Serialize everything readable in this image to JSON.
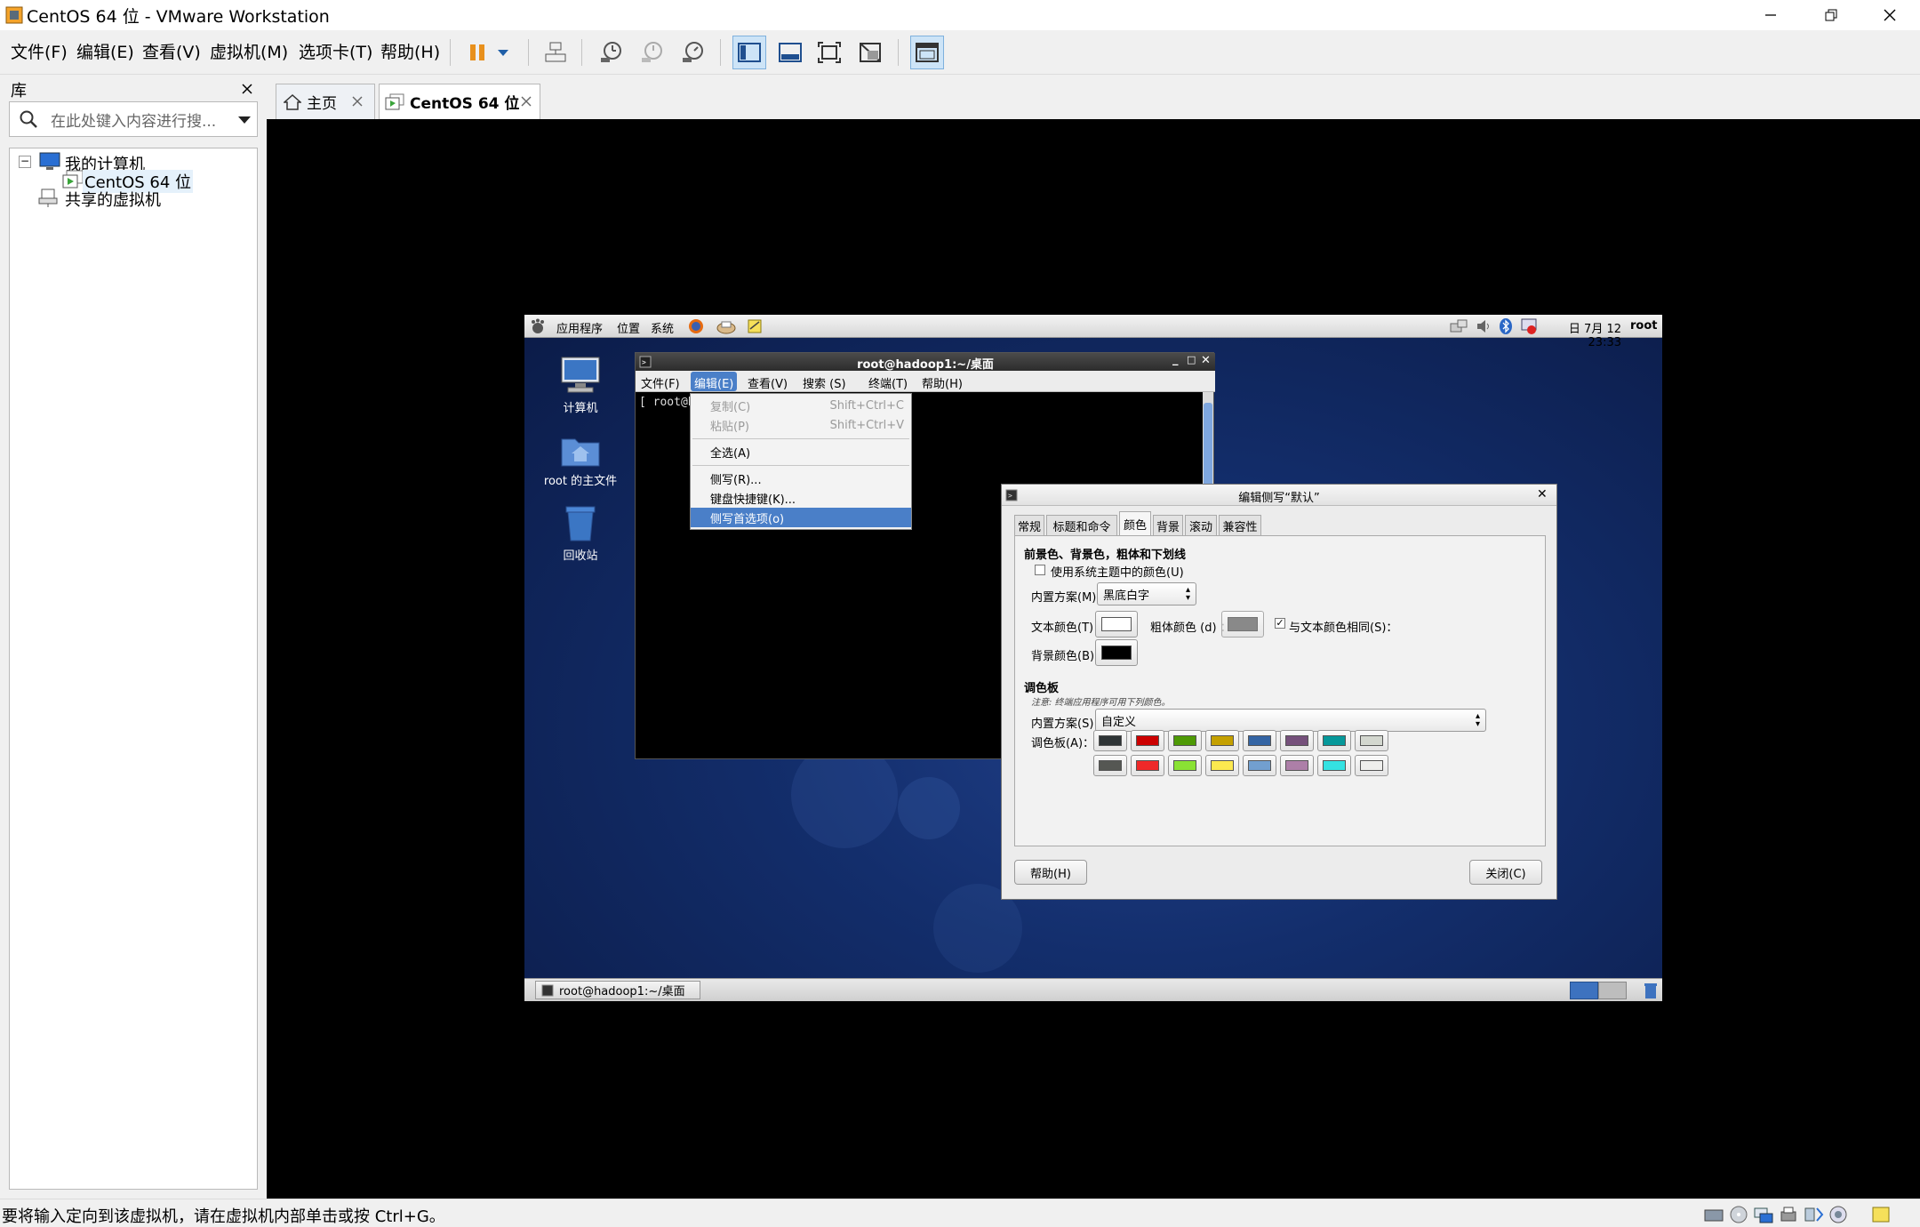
{
  "window": {
    "title": "CentOS 64 位 - VMware Workstation"
  },
  "menubar": {
    "items": [
      "文件(F)",
      "编辑(E)",
      "查看(V)",
      "虚拟机(M)",
      "选项卡(T)",
      "帮助(H)"
    ]
  },
  "library": {
    "title": "库",
    "search_placeholder": "在此处键入内容进行搜...",
    "tree": {
      "root": "我的计算机",
      "vm": "CentOS 64 位",
      "shared": "共享的虚拟机"
    }
  },
  "tabs": [
    {
      "label": "主页",
      "icon": "home-icon"
    },
    {
      "label": "CentOS 64 位",
      "icon": "vm-icon"
    }
  ],
  "status": {
    "message": "要将输入定向到该虚拟机，请在虚拟机内部单击或按 Ctrl+G。"
  },
  "guest": {
    "panel": {
      "menus": [
        "应用程序",
        "位置",
        "系统"
      ],
      "clock": "日 7月 12 23:33",
      "user": "root"
    },
    "desktop_icons": [
      "计算机",
      "root 的主文件",
      "回收站"
    ],
    "taskbar_item": "root@hadoop1:~/桌面",
    "terminal": {
      "title": "root@hadoop1:~/桌面",
      "menus": [
        "文件(F)",
        "编辑(E)",
        "查看(V)",
        "搜索 (S)",
        "终端(T)",
        "帮助(H)"
      ],
      "prompt": "[ root@ha"
    },
    "edit_menu": {
      "items": [
        {
          "label": "复制(C)",
          "shortcut": "Shift+Ctrl+C",
          "disabled": true
        },
        {
          "label": "粘贴(P)",
          "shortcut": "Shift+Ctrl+V",
          "disabled": true
        },
        {
          "label": "全选(A)",
          "shortcut": "",
          "disabled": false
        },
        {
          "label": "侧写(R)...",
          "shortcut": "",
          "disabled": false
        },
        {
          "label": "键盘快捷键(K)...",
          "shortcut": "",
          "disabled": false
        },
        {
          "label": "侧写首选项(o)",
          "shortcut": "",
          "disabled": false,
          "highlighted": true
        }
      ]
    },
    "profile_dialog": {
      "title": "编辑侧写“默认”",
      "tabs": [
        "常规",
        "标题和命令",
        "颜色",
        "背景",
        "滚动",
        "兼容性"
      ],
      "active_tab": "颜色",
      "section1": "前景色、背景色，粗体和下划线",
      "use_system_colors": "使用系统主题中的颜色(U)",
      "builtin_scheme_label": "内置方案(M)：",
      "builtin_scheme_value": "黑底白字",
      "text_color_label": "文本颜色(T)：",
      "bold_color_label": "粗体颜色 (d) ：",
      "same_as_text": "与文本颜色相同(S)：",
      "bg_color_label": "背景颜色(B)：",
      "text_color": "#ffffff",
      "bold_color": "#707070",
      "bg_color": "#000000",
      "section2": "调色板",
      "note": "注意: 终端应用程序可用下列颜色。",
      "palette_scheme_label": "内置方案(S)：",
      "palette_scheme_value": "自定义",
      "palette_label": "调色板(A)：",
      "palette": [
        "#2e3436",
        "#cc0000",
        "#4e9a06",
        "#c4a000",
        "#3465a4",
        "#75507b",
        "#06989a",
        "#d3d7cf",
        "#555753",
        "#ef2929",
        "#8ae234",
        "#fce94f",
        "#729fcf",
        "#ad7fa8",
        "#34e2e2",
        "#eeeeec"
      ],
      "help_button": "帮助(H)",
      "close_button": "关闭(C)"
    }
  }
}
